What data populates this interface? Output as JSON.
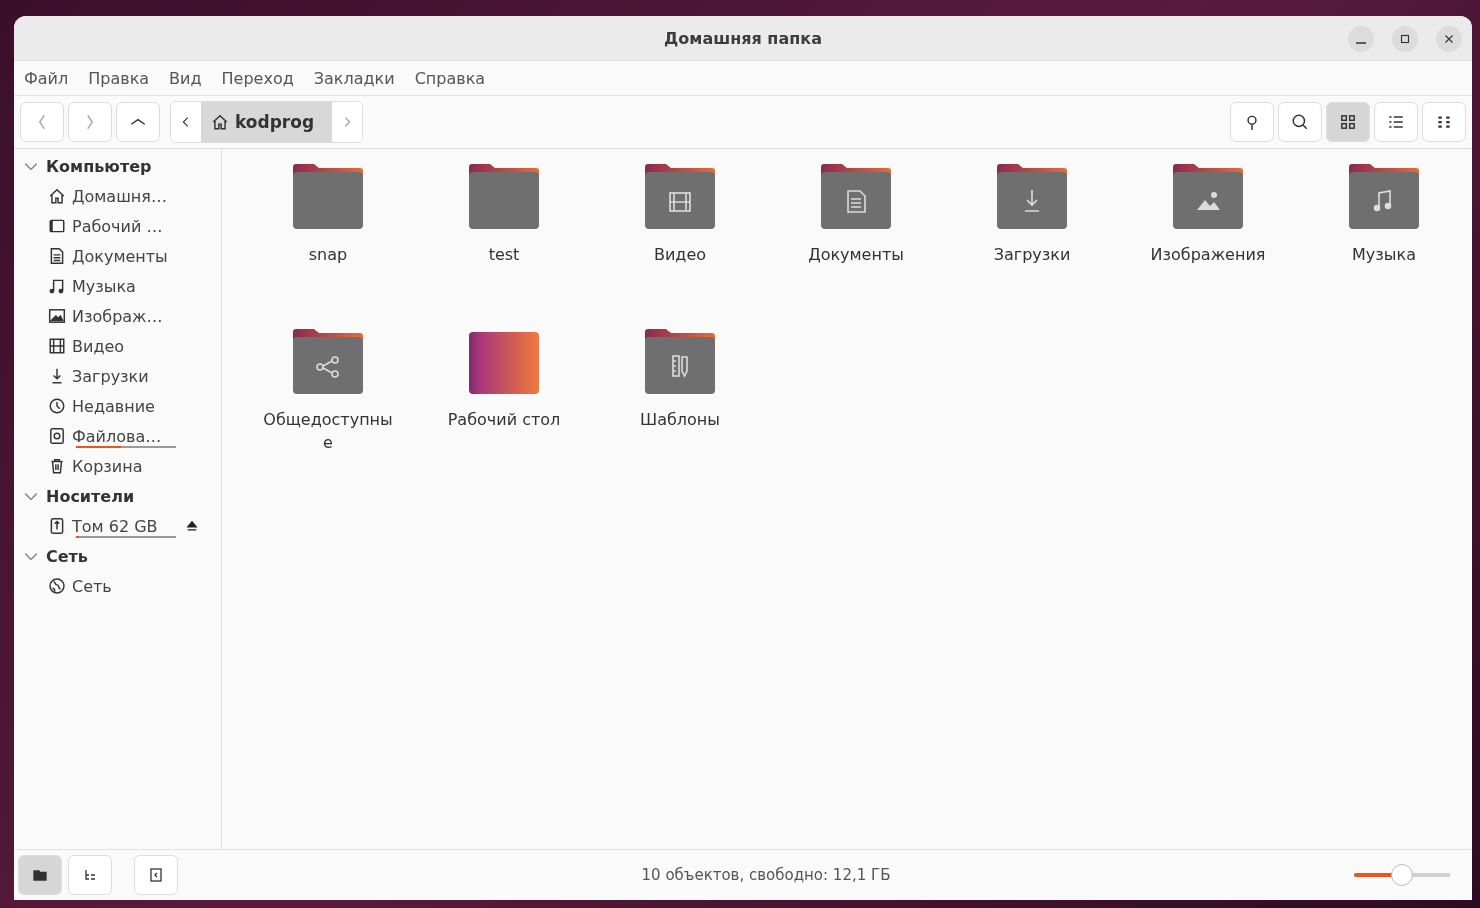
{
  "window": {
    "title": "Домашняя папка"
  },
  "menu": [
    "Файл",
    "Правка",
    "Вид",
    "Переход",
    "Закладки",
    "Справка"
  ],
  "path": {
    "current": "kodprog"
  },
  "view_buttons": [
    {
      "kind": "location",
      "selected": false
    },
    {
      "kind": "search",
      "selected": false
    },
    {
      "kind": "grid",
      "selected": true
    },
    {
      "kind": "list",
      "selected": false
    },
    {
      "kind": "options",
      "selected": false
    }
  ],
  "sidebar": {
    "sections": [
      {
        "title": "Компьютер",
        "items": [
          {
            "label": "Домашня…",
            "kind": "home"
          },
          {
            "label": "Рабочий …",
            "kind": "desktop"
          },
          {
            "label": "Документы",
            "kind": "documents"
          },
          {
            "label": "Музыка",
            "kind": "music"
          },
          {
            "label": "Изображ…",
            "kind": "pictures"
          },
          {
            "label": "Видео",
            "kind": "video"
          },
          {
            "label": "Загрузки",
            "kind": "downloads"
          },
          {
            "label": "Недавние",
            "kind": "recent"
          },
          {
            "label": "Файлова…",
            "kind": "filesystem",
            "level": 0.45
          },
          {
            "label": "Корзина",
            "kind": "trash"
          }
        ]
      },
      {
        "title": "Носители",
        "items": [
          {
            "label": "Том 62 GB",
            "kind": "usb",
            "level": 0.03
          }
        ]
      },
      {
        "title": "Сеть",
        "items": [
          {
            "label": "Сеть",
            "kind": "network"
          }
        ]
      }
    ]
  },
  "files": [
    {
      "name": "snap",
      "kind": "folder"
    },
    {
      "name": "test",
      "kind": "folder"
    },
    {
      "name": "Видео",
      "kind": "video"
    },
    {
      "name": "Документы",
      "kind": "documents"
    },
    {
      "name": "Загрузки",
      "kind": "downloads"
    },
    {
      "name": "Изображения",
      "kind": "pictures"
    },
    {
      "name": "Музыка",
      "kind": "music"
    },
    {
      "name": "Общедоступные",
      "kind": "share"
    },
    {
      "name": "Рабочий стол",
      "kind": "desktop"
    },
    {
      "name": "Шаблоны",
      "kind": "templates"
    }
  ],
  "status_bar": {
    "text": "10 объектов, свободно: 12,1 ГБ",
    "zoom": {
      "level": 0.5
    },
    "buttons": [
      {
        "kind": "places",
        "selected": true
      },
      {
        "kind": "tree",
        "selected": false
      },
      {
        "kind": "collapse",
        "selected": false
      }
    ]
  }
}
